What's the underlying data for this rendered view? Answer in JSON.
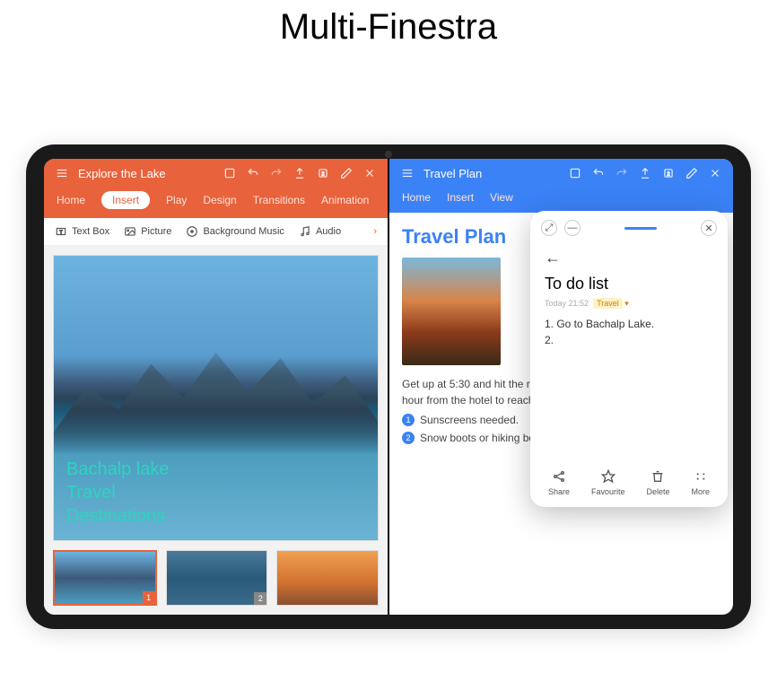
{
  "page_title": "Multi-Finestra",
  "left_pane": {
    "app_title": "Explore the Lake",
    "tabs": [
      "Home",
      "Insert",
      "Play",
      "Design",
      "Transitions",
      "Animation"
    ],
    "active_tab_index": 1,
    "toolbar": [
      {
        "icon": "text-box-icon",
        "label": "Text Box"
      },
      {
        "icon": "picture-icon",
        "label": "Picture"
      },
      {
        "icon": "music-icon",
        "label": "Background Music"
      },
      {
        "icon": "audio-icon",
        "label": "Audio"
      }
    ],
    "slide_text": "Bachalp lake\nTravel\nDestinations",
    "thumb_numbers": [
      "1",
      "2",
      ""
    ]
  },
  "right_pane": {
    "app_title": "Travel Plan",
    "tabs": [
      "Home",
      "Insert",
      "View"
    ],
    "doc_title": "Travel Plan",
    "body_text": "Get up at 5:30 and hit the ro\nhour from the hotel to reach",
    "bullets": [
      "Sunscreens needed.",
      "Snow boots or hiking boots."
    ]
  },
  "popup": {
    "title": "To do list",
    "timestamp": "Today 21:52",
    "tag": "Travel",
    "items": [
      "1. Go to Bachalp Lake.",
      "2."
    ],
    "actions": [
      {
        "icon": "share-icon",
        "label": "Share"
      },
      {
        "icon": "star-icon",
        "label": "Favourite"
      },
      {
        "icon": "trash-icon",
        "label": "Delete"
      },
      {
        "icon": "more-icon",
        "label": "More"
      }
    ]
  }
}
